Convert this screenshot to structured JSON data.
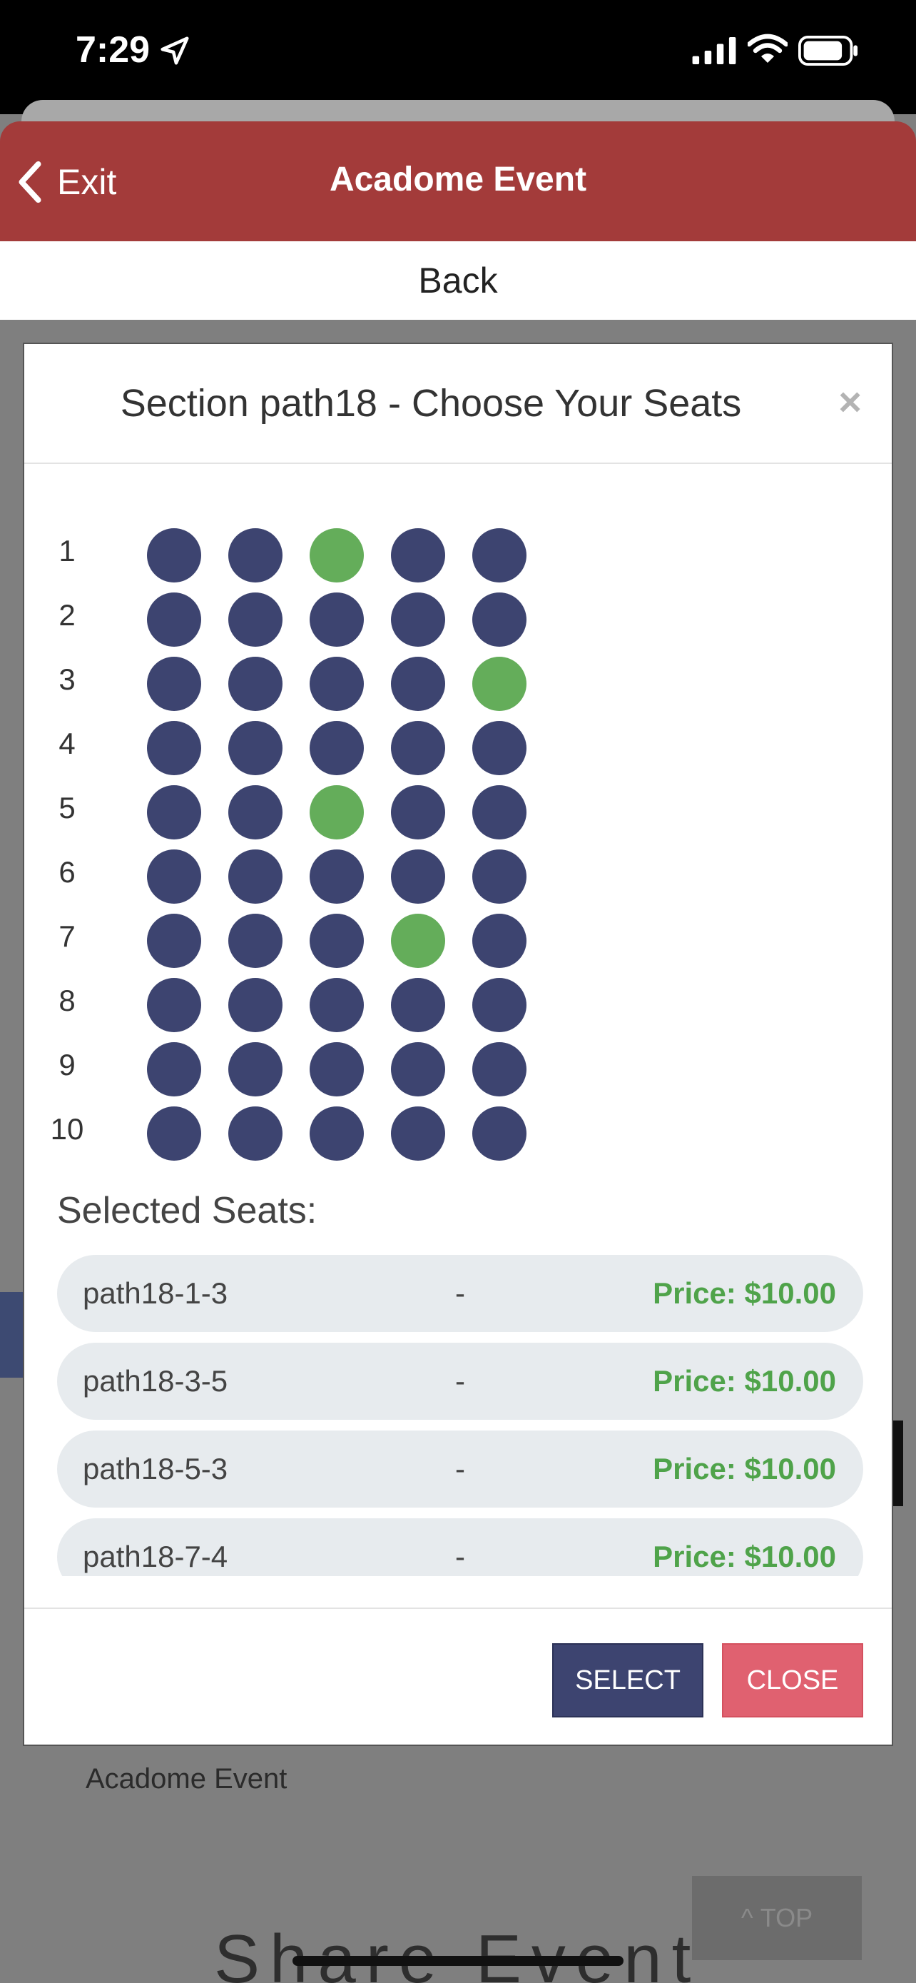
{
  "status_bar": {
    "time": "7:29"
  },
  "nav": {
    "exit_label": "Exit",
    "title": "Acadome Event"
  },
  "back_label": "Back",
  "modal": {
    "title": "Section path18 - Choose Your Seats",
    "close_symbol": "×",
    "rows": [
      {
        "label": "1",
        "seats": [
          false,
          false,
          true,
          false,
          false
        ]
      },
      {
        "label": "2",
        "seats": [
          false,
          false,
          false,
          false,
          false
        ]
      },
      {
        "label": "3",
        "seats": [
          false,
          false,
          false,
          false,
          true
        ]
      },
      {
        "label": "4",
        "seats": [
          false,
          false,
          false,
          false,
          false
        ]
      },
      {
        "label": "5",
        "seats": [
          false,
          false,
          true,
          false,
          false
        ]
      },
      {
        "label": "6",
        "seats": [
          false,
          false,
          false,
          false,
          false
        ]
      },
      {
        "label": "7",
        "seats": [
          false,
          false,
          false,
          true,
          false
        ]
      },
      {
        "label": "8",
        "seats": [
          false,
          false,
          false,
          false,
          false
        ]
      },
      {
        "label": "9",
        "seats": [
          false,
          false,
          false,
          false,
          false
        ]
      },
      {
        "label": "10",
        "seats": [
          false,
          false,
          false,
          false,
          false
        ]
      }
    ],
    "selected_heading": "Selected Seats:",
    "selected": [
      {
        "seat": "path18-1-3",
        "sep": "-",
        "price": "Price: $10.00"
      },
      {
        "seat": "path18-3-5",
        "sep": "-",
        "price": "Price: $10.00"
      },
      {
        "seat": "path18-5-3",
        "sep": "-",
        "price": "Price: $10.00"
      },
      {
        "seat": "path18-7-4",
        "sep": "-",
        "price": "Price: $10.00"
      }
    ],
    "select_label": "SELECT",
    "close_label": "CLOSE"
  },
  "background": {
    "event_name": "Acadome Event",
    "top_label": "TOP",
    "share_label": "Share Event"
  },
  "colors": {
    "nav": "#a33b3a",
    "seat_available": "#3d4470",
    "seat_selected": "#64ad5a",
    "price": "#4fa34a",
    "close_button": "#e06170"
  }
}
